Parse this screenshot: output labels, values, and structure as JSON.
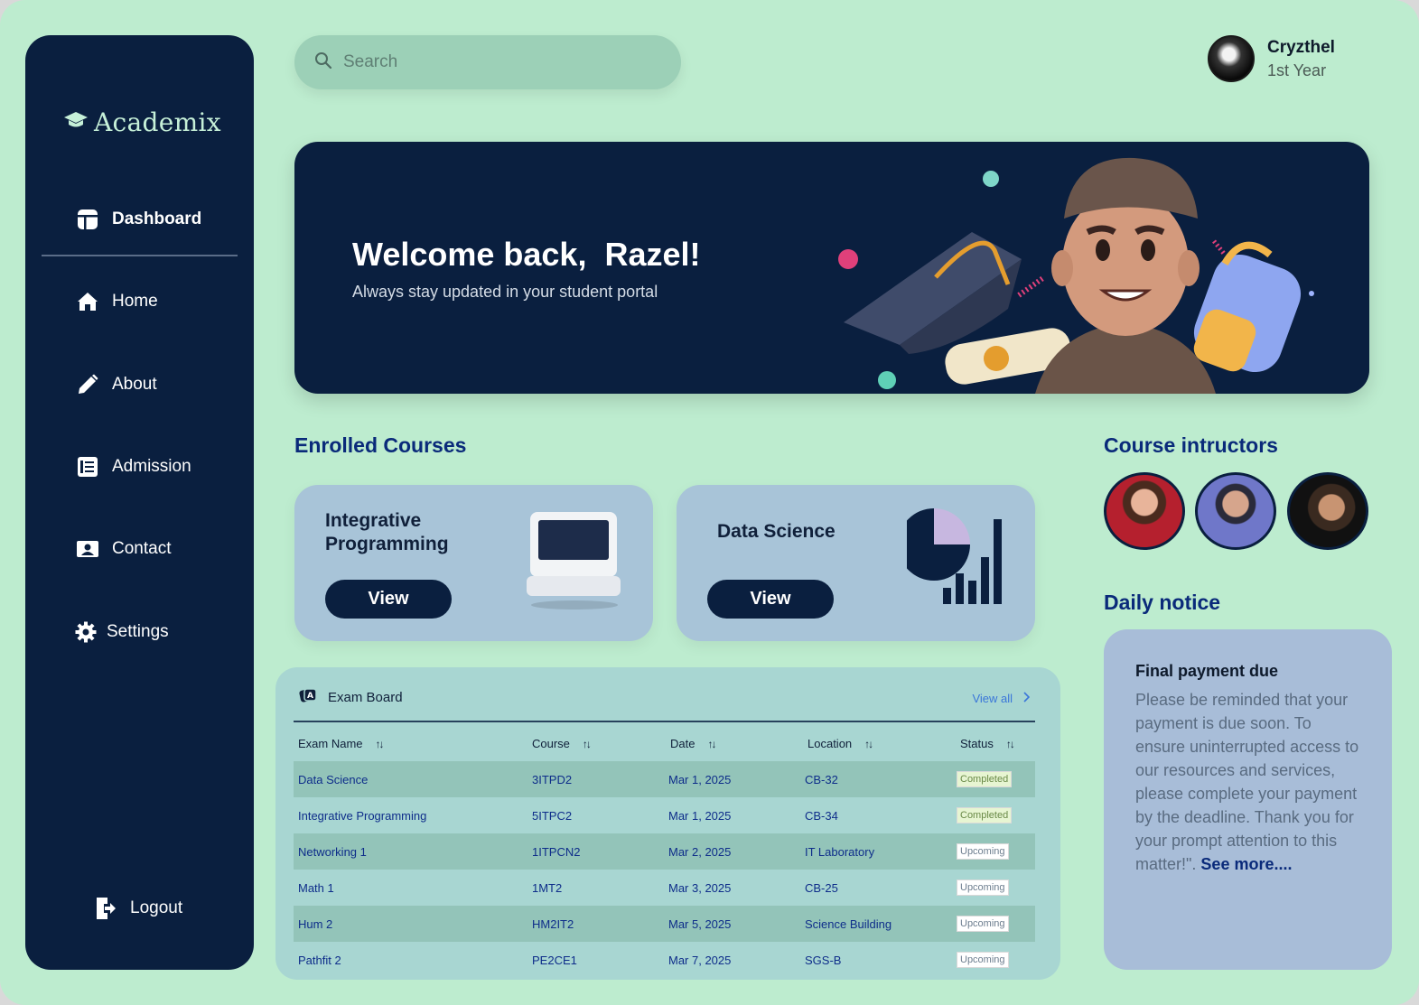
{
  "sidebar": {
    "brand": "Academix",
    "items": [
      {
        "label": "Dashboard"
      },
      {
        "label": "Home"
      },
      {
        "label": "About"
      },
      {
        "label": "Admission"
      },
      {
        "label": "Contact"
      },
      {
        "label": "Settings"
      }
    ],
    "logout": "Logout"
  },
  "search": {
    "placeholder": "Search"
  },
  "profile": {
    "name": "Cryzthel",
    "year": "1st Year"
  },
  "hero": {
    "title": "Welcome back,  Razel!",
    "subtitle": "Always stay updated in your student portal"
  },
  "enrolled": {
    "title": "Enrolled Courses",
    "courses": [
      {
        "title": "Integrative Programming",
        "button": "View"
      },
      {
        "title": "Data Science",
        "button": "View"
      }
    ]
  },
  "instructors": {
    "title": "Course intructors"
  },
  "notice": {
    "section_title": "Daily notice",
    "title": "Final payment due",
    "body": "Please be reminded that your payment is due soon. To ensure uninterrupted access to our resources and services, please complete your payment by the deadline. Thank you for your prompt attention to this matter!\".",
    "see_more": "See more...."
  },
  "exam_board": {
    "title": "Exam Board",
    "view_all": "View all",
    "columns": [
      "Exam Name",
      "Course",
      "Date",
      "Location",
      "Status"
    ],
    "rows": [
      {
        "name": "Data Science",
        "course": "3ITPD2",
        "date": "Mar 1, 2025",
        "location": "CB-32",
        "status": "Completed"
      },
      {
        "name": "Integrative Programming",
        "course": "5ITPC2",
        "date": "Mar 1, 2025",
        "location": "CB-34",
        "status": "Completed"
      },
      {
        "name": "Networking 1",
        "course": "1ITPCN2",
        "date": "Mar 2, 2025",
        "location": "IT Laboratory",
        "status": "Upcoming"
      },
      {
        "name": "Math 1",
        "course": "1MT2",
        "date": "Mar 3, 2025",
        "location": "CB-25",
        "status": "Upcoming"
      },
      {
        "name": "Hum 2",
        "course": "HM2IT2",
        "date": "Mar 5, 2025",
        "location": "Science Building",
        "status": "Upcoming"
      },
      {
        "name": "Pathfit 2",
        "course": "PE2CE1",
        "date": "Mar 7, 2025",
        "location": "SGS-B",
        "status": "Upcoming"
      }
    ]
  },
  "colors": {
    "navy": "#0a1f3f",
    "mint": "#bdeccf",
    "accent_blue": "#0a2a7a",
    "link": "#3a76d9"
  }
}
